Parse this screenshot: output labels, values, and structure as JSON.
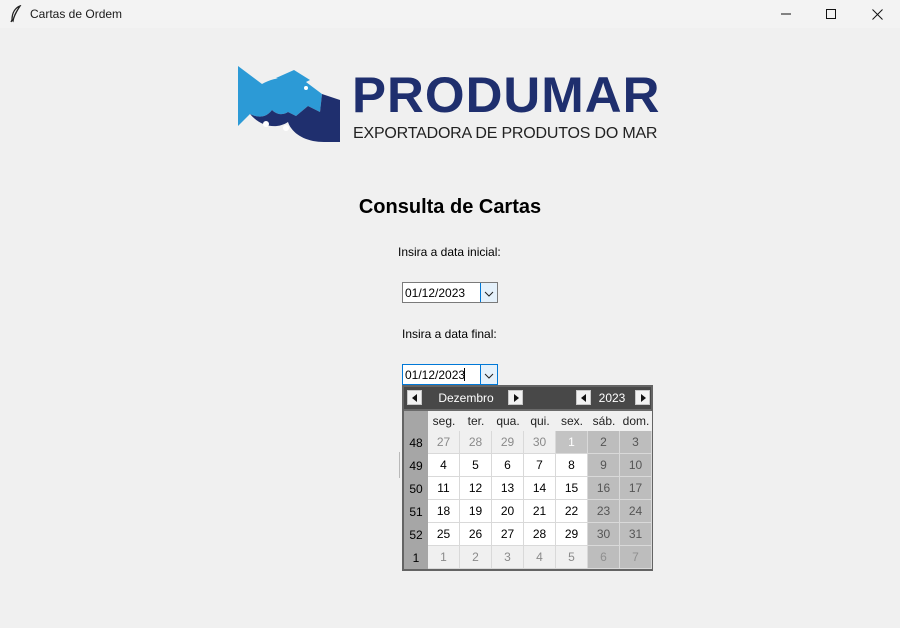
{
  "window": {
    "title": "Cartas de Ordem",
    "icon": "feather-icon",
    "controls": [
      "minimize-icon",
      "maximize-icon",
      "close-icon"
    ]
  },
  "logo": {
    "name": "PRODUMAR",
    "subtitle": "EXPORTADORA DE PRODUTOS DO MAR",
    "colors": {
      "navy": "#1f2f6e",
      "blue": "#2c9ad6"
    }
  },
  "page": {
    "heading": "Consulta de Cartas",
    "start_label": "Insira a data inicial:",
    "start_value": "01/12/2023",
    "end_label": "Insira a data final:",
    "end_value": "01/12/2023"
  },
  "calendar": {
    "month": "Dezembro",
    "year": "2023",
    "weekdays": [
      "seg.",
      "ter.",
      "qua.",
      "qui.",
      "sex.",
      "sáb.",
      "dom."
    ],
    "weeks": [
      {
        "number": "48",
        "days": [
          {
            "d": "27",
            "other": true
          },
          {
            "d": "28",
            "other": true
          },
          {
            "d": "29",
            "other": true
          },
          {
            "d": "30",
            "other": true
          },
          {
            "d": "1",
            "selected": true
          },
          {
            "d": "2"
          },
          {
            "d": "3"
          }
        ]
      },
      {
        "number": "49",
        "days": [
          {
            "d": "4"
          },
          {
            "d": "5"
          },
          {
            "d": "6"
          },
          {
            "d": "7"
          },
          {
            "d": "8"
          },
          {
            "d": "9"
          },
          {
            "d": "10"
          }
        ]
      },
      {
        "number": "50",
        "days": [
          {
            "d": "11"
          },
          {
            "d": "12"
          },
          {
            "d": "13"
          },
          {
            "d": "14"
          },
          {
            "d": "15"
          },
          {
            "d": "16"
          },
          {
            "d": "17"
          }
        ]
      },
      {
        "number": "51",
        "days": [
          {
            "d": "18"
          },
          {
            "d": "19"
          },
          {
            "d": "20"
          },
          {
            "d": "21"
          },
          {
            "d": "22"
          },
          {
            "d": "23"
          },
          {
            "d": "24"
          }
        ]
      },
      {
        "number": "52",
        "days": [
          {
            "d": "25"
          },
          {
            "d": "26"
          },
          {
            "d": "27"
          },
          {
            "d": "28"
          },
          {
            "d": "29"
          },
          {
            "d": "30"
          },
          {
            "d": "31"
          }
        ]
      },
      {
        "number": "1",
        "days": [
          {
            "d": "1",
            "other": true
          },
          {
            "d": "2",
            "other": true
          },
          {
            "d": "3",
            "other": true
          },
          {
            "d": "4",
            "other": true
          },
          {
            "d": "5",
            "other": true
          },
          {
            "d": "6",
            "other": true
          },
          {
            "d": "7",
            "other": true
          }
        ]
      }
    ]
  }
}
